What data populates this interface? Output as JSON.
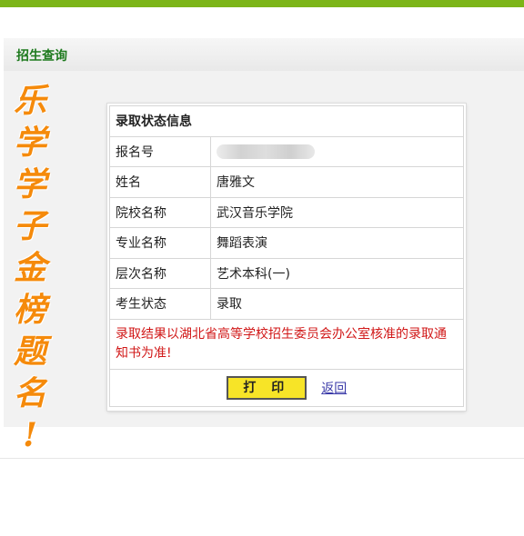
{
  "section": {
    "title": "招生查询"
  },
  "card": {
    "heading": "录取状态信息",
    "rows": [
      {
        "label": "报名号",
        "value": ""
      },
      {
        "label": "姓名",
        "value": "唐雅文"
      },
      {
        "label": "院校名称",
        "value": "武汉音乐学院"
      },
      {
        "label": "专业名称",
        "value": "舞蹈表演"
      },
      {
        "label": "层次名称",
        "value": "艺术本科(一)"
      },
      {
        "label": "考生状态",
        "value": "录取"
      }
    ],
    "notice": "录取结果以湖北省高等学校招生委员会办公室核准的录取通知书为准!",
    "print_label": "打 印",
    "back_label": "返回"
  },
  "overlay": {
    "chars": [
      "乐",
      "学",
      "学",
      "子",
      "金",
      "榜",
      "题",
      "名",
      "!"
    ],
    "color": "#f58a0b"
  },
  "colors": {
    "top_bar": "#7cb518",
    "section_title": "#1e7a1e",
    "notice_text": "#d11818",
    "print_button": "#f7e427"
  }
}
